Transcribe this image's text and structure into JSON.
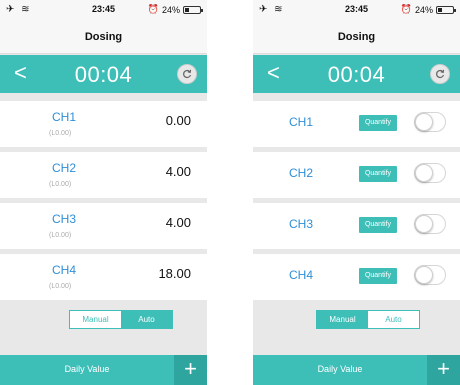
{
  "status": {
    "signal": "✈ ≋",
    "time": "23:45",
    "alarm": "⏰",
    "battery": "24%",
    "battery_level": 0.24
  },
  "left_screen": {
    "title": "Dosing",
    "back": "<",
    "timer": "00:04",
    "channels": [
      {
        "name": "CH1",
        "sub": "(L0.00)",
        "value": "0.00"
      },
      {
        "name": "CH2",
        "sub": "(L0.00)",
        "value": "4.00"
      },
      {
        "name": "CH3",
        "sub": "(L0.00)",
        "value": "4.00"
      },
      {
        "name": "CH4",
        "sub": "(L0.00)",
        "value": "18.00"
      }
    ],
    "modes": {
      "manual": "Manual",
      "auto": "Auto",
      "active": "auto"
    },
    "bottom": {
      "daily": "Daily Value",
      "plus": "+"
    }
  },
  "right_screen": {
    "title": "Dosing",
    "back": "<",
    "timer": "00:04",
    "channels": [
      {
        "name": "CH1",
        "action": "Quantify",
        "on": false
      },
      {
        "name": "CH2",
        "action": "Quantify",
        "on": false
      },
      {
        "name": "CH3",
        "action": "Quantify",
        "on": false
      },
      {
        "name": "CH4",
        "action": "Quantify",
        "on": false
      }
    ],
    "modes": {
      "manual": "Manual",
      "auto": "Auto",
      "active": "manual"
    },
    "bottom": {
      "daily": "Daily Value",
      "plus": "+"
    }
  },
  "colors": {
    "accent": "#3dbfb8",
    "accent_dark": "#2ea59f",
    "channel_text": "#2f8fd7"
  }
}
